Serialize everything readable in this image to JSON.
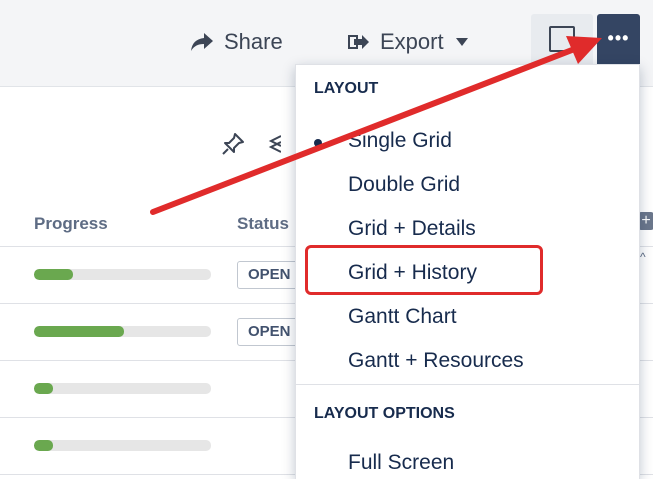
{
  "toolbar": {
    "share_label": "Share",
    "export_label": "Export",
    "view_icon": "square-icon",
    "more_icon": "ellipsis-icon"
  },
  "grid": {
    "columns": [
      "Progress",
      "Status"
    ],
    "rows": [
      {
        "progress": 0.22,
        "status": "OPEN"
      },
      {
        "progress": 0.51,
        "status": "OPEN"
      },
      {
        "progress": 0.11,
        "status": ""
      },
      {
        "progress": 0.11,
        "status": ""
      }
    ]
  },
  "menu": {
    "layout_heading": "LAYOUT",
    "layout_items": [
      "Single Grid",
      "Double Grid",
      "Grid + Details",
      "Grid + History",
      "Gantt Chart",
      "Gantt + Resources"
    ],
    "selected_item": "Single Grid",
    "highlighted_item": "Grid + History",
    "options_heading": "LAYOUT OPTIONS",
    "options_items": [
      "Full Screen"
    ]
  },
  "annotation": {
    "color": "#e02b2b"
  },
  "colors": {
    "progress_fill": "#6aa84f",
    "more_button": "#344563"
  }
}
